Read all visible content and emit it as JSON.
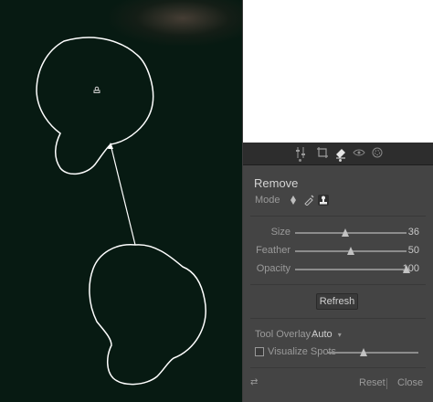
{
  "canvas": {
    "pin_icon": "stamp-pin-icon"
  },
  "tool_strip": {
    "icons": [
      "sliders-icon",
      "crop-icon",
      "eraser-icon",
      "redeye-icon",
      "mask-icon"
    ]
  },
  "panel": {
    "title": "Remove",
    "mode_label": "Mode",
    "mode_icons": [
      "heal-icon",
      "brush-icon",
      "clone-stamp-icon"
    ],
    "sliders": [
      {
        "label": "Size",
        "value": "36",
        "fraction": 0.45
      },
      {
        "label": "Feather",
        "value": "50",
        "fraction": 0.5
      },
      {
        "label": "Opacity",
        "value": "100",
        "fraction": 1.0
      }
    ],
    "refresh_label": "Refresh",
    "tool_overlay_label": "Tool Overlay :",
    "tool_overlay_value": "Auto",
    "visualize_label": "Visualize Spots",
    "visualize_fraction": 0.4,
    "reset_label": "Reset",
    "close_label": "Close",
    "collapse_icon": "double-arrow-icon"
  },
  "colors": {
    "photo_bg": "#071a12",
    "panel_bg": "#444444",
    "overlay_stroke": "#ffffff"
  }
}
